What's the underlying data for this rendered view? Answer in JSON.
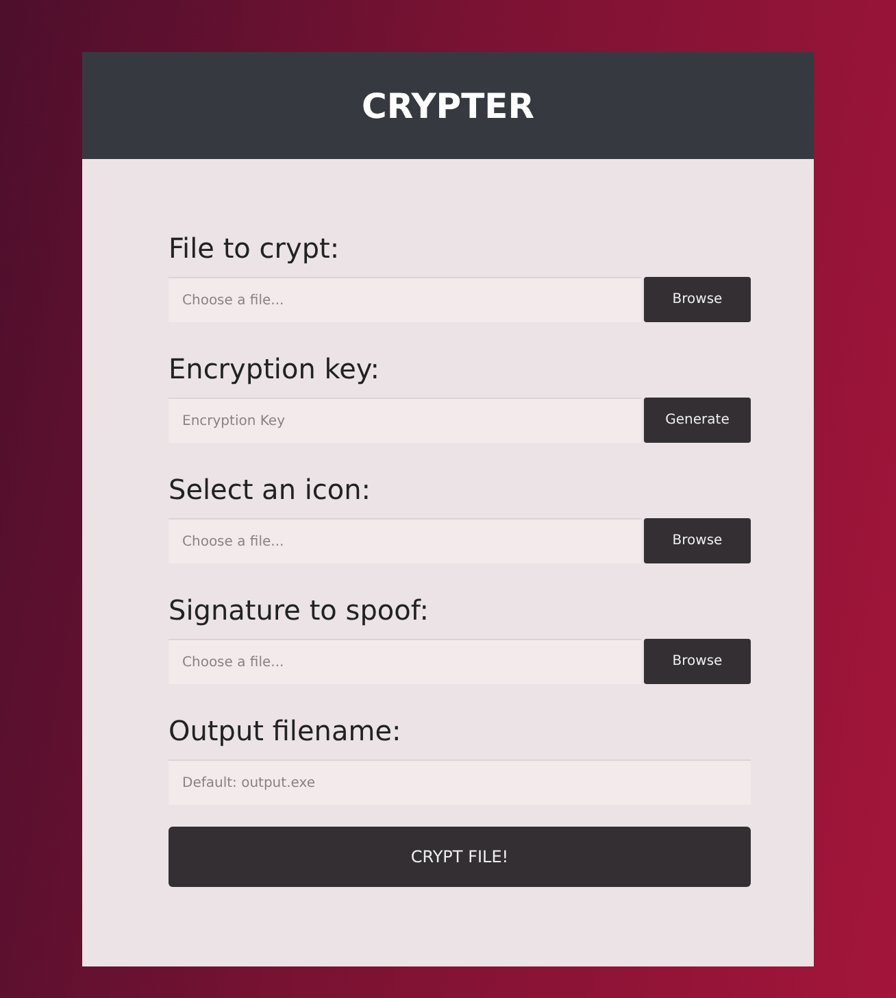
{
  "header": {
    "title": "CRYPTER"
  },
  "fields": [
    {
      "label": "File to crypt:",
      "placeholder": "Choose a file...",
      "button": "Browse"
    },
    {
      "label": "Encryption key:",
      "placeholder": "Encryption Key",
      "button": "Generate"
    },
    {
      "label": "Select an icon:",
      "placeholder": "Choose a file...",
      "button": "Browse"
    },
    {
      "label": "Signature to spoof:",
      "placeholder": "Choose a file...",
      "button": "Browse"
    },
    {
      "label": "Output filename:",
      "placeholder": "Default: output.exe"
    }
  ],
  "submit": "CRYPT FILE!"
}
